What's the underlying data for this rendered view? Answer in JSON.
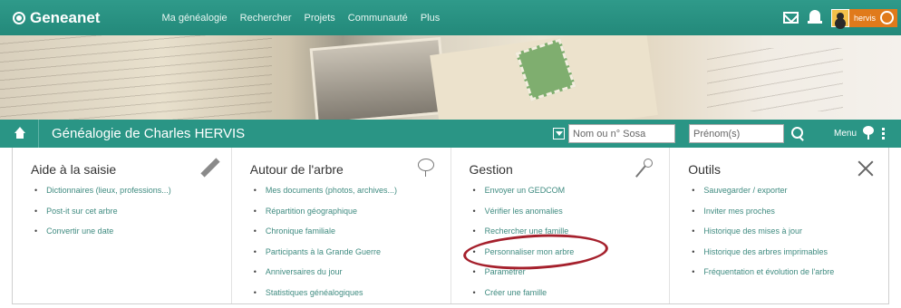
{
  "topbar": {
    "brand": "Geneanet",
    "nav": [
      "Ma généalogie",
      "Rechercher",
      "Projets",
      "Communauté",
      "Plus"
    ],
    "user_name": "hervis"
  },
  "genealogy_bar": {
    "title": "Généalogie de Charles HERVIS",
    "sosa_placeholder": "Nom ou n° Sosa",
    "prenom_placeholder": "Prénom(s)",
    "menu_label": "Menu"
  },
  "columns": [
    {
      "title": "Aide à la saisie",
      "items": [
        "Dictionnaires (lieux, professions...)",
        "Post-it sur cet arbre",
        "Convertir une date"
      ]
    },
    {
      "title": "Autour de l'arbre",
      "items": [
        "Mes documents (photos, archives...)",
        "Répartition géographique",
        "Chronique familiale",
        "Participants à la Grande Guerre",
        "Anniversaires du jour",
        "Statistiques généalogiques"
      ]
    },
    {
      "title": "Gestion",
      "items": [
        "Envoyer un GEDCOM",
        "Vérifier les anomalies",
        "Rechercher une famille",
        "Personnaliser mon arbre",
        "Paramétrer",
        "Créer une famille"
      ]
    },
    {
      "title": "Outils",
      "items": [
        "Sauvegarder / exporter",
        "Inviter mes proches",
        "Historique des mises à jour",
        "Historique des arbres imprimables",
        "Fréquentation et évolution de l'arbre"
      ]
    }
  ],
  "colors": {
    "brand_teal": "#2a9585",
    "link": "#3f8b80",
    "user_badge": "#e07a1b",
    "annotation": "#a5202c"
  }
}
